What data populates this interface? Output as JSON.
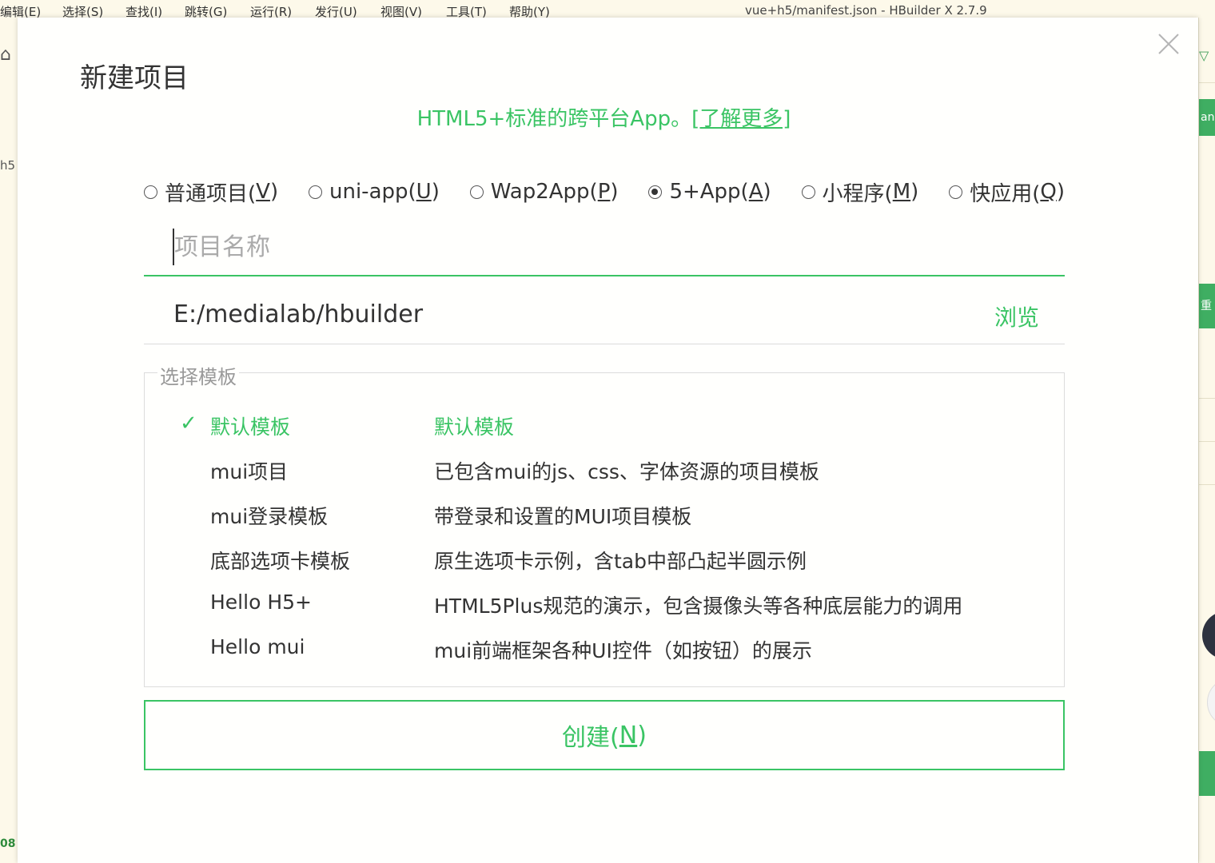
{
  "background": {
    "menubar": [
      "编辑(E)",
      "选择(S)",
      "查找(I)",
      "跳转(G)",
      "运行(R)",
      "发行(U)",
      "视图(V)",
      "工具(T)",
      "帮助(Y)"
    ],
    "window_title": "vue+h5/manifest.json - HBuilder X 2.7.9",
    "left_text": "h5",
    "left_number": "08",
    "right_tab_top": "an",
    "right_tab_mid": "重"
  },
  "dialog": {
    "title": "新建项目",
    "subtitle_text": "HTML5+标准的跨平台App。",
    "subtitle_link": "[了解更多]",
    "close_icon": "close-icon",
    "project_types": [
      {
        "label": "普通项目(",
        "key": "V",
        "end": ")",
        "checked": false
      },
      {
        "label": "uni-app(",
        "key": "U",
        "end": ")",
        "checked": false
      },
      {
        "label": "Wap2App(",
        "key": "P",
        "end": ")",
        "checked": false
      },
      {
        "label": "5+App(",
        "key": "A",
        "end": ")",
        "checked": true
      },
      {
        "label": "小程序(",
        "key": "M",
        "end": ")",
        "checked": false
      },
      {
        "label": "快应用(",
        "key": "Q",
        "end": ")",
        "checked": false
      }
    ],
    "name_input": {
      "placeholder": "项目名称",
      "value": ""
    },
    "path": {
      "value": "E:/medialab/hbuilder",
      "browse_label": "浏览"
    },
    "templates": {
      "legend": "选择模板",
      "items": [
        {
          "name": "默认模板",
          "desc": "默认模板",
          "selected": true
        },
        {
          "name": "mui项目",
          "desc": "已包含mui的js、css、字体资源的项目模板",
          "selected": false
        },
        {
          "name": "mui登录模板",
          "desc": "带登录和设置的MUI项目模板",
          "selected": false
        },
        {
          "name": "底部选项卡模板",
          "desc": "原生选项卡示例，含tab中部凸起半圆示例",
          "selected": false
        },
        {
          "name": "Hello H5+",
          "desc": "HTML5Plus规范的演示，包含摄像头等各种底层能力的调用",
          "selected": false
        },
        {
          "name": "Hello mui",
          "desc": "mui前端框架各种UI控件（如按钮）的展示",
          "selected": false
        }
      ]
    },
    "create_button": {
      "label": "创建(",
      "key": "N",
      "end": ")"
    },
    "colors": {
      "accent": "#3ac464",
      "text": "#333333",
      "border": "#dcdcdc"
    }
  }
}
